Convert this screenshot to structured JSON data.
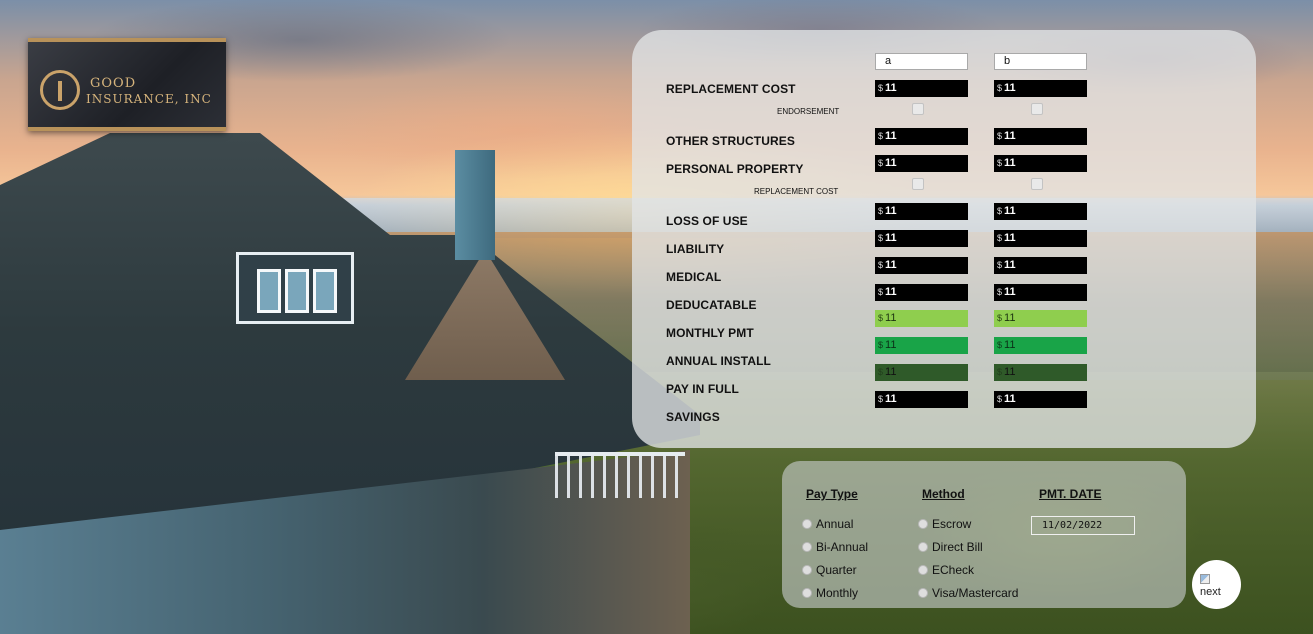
{
  "brand": {
    "line1": "GOOD",
    "line2": "INSURANCE, INC"
  },
  "columns": {
    "a_value": "a",
    "b_value": "b"
  },
  "currency_symbol": "$",
  "rows": {
    "replacement_cost": {
      "label": "REPLACEMENT COST",
      "a": "11",
      "b": "11"
    },
    "endorsement": {
      "label": "ENDORSEMENT"
    },
    "other_structures": {
      "label": "OTHER STRUCTURES",
      "a": "11",
      "b": "11"
    },
    "personal_property": {
      "label": "PERSONAL PROPERTY",
      "a": "11",
      "b": "11"
    },
    "pp_replacement_cost": {
      "label": "REPLACEMENT COST"
    },
    "loss_of_use": {
      "label": "LOSS OF USE",
      "a": "11",
      "b": "11"
    },
    "liability": {
      "label": "LIABILITY",
      "a": "11",
      "b": "11"
    },
    "medical": {
      "label": "MEDICAL",
      "a": "11",
      "b": "11"
    },
    "deducatable": {
      "label": "DEDUCATABLE",
      "a": "11",
      "b": "11"
    },
    "monthly_pmt": {
      "label": "MONTHLY PMT",
      "a": "11",
      "b": "11"
    },
    "annual_install": {
      "label": "ANNUAL INSTALL",
      "a": "11",
      "b": "11"
    },
    "pay_in_full": {
      "label": "PAY IN FULL",
      "a": "11",
      "b": "11"
    },
    "savings": {
      "label": "SAVINGS",
      "a": "11",
      "b": "11"
    }
  },
  "payment": {
    "pay_type_heading": "Pay Type",
    "pay_types": [
      "Annual",
      "Bi-Annual",
      "Quarter",
      "Monthly"
    ],
    "method_heading": "Method",
    "methods": [
      "Escrow",
      "Direct Bill",
      "ECheck",
      "Visa/Mastercard"
    ],
    "date_heading": "PMT. DATE",
    "date_value": "11/02/2022"
  },
  "next_button": {
    "alt_text": "next"
  },
  "colors": {
    "input_black": "#000000",
    "monthly_lime": "#8fce4e",
    "annual_green": "#19a448",
    "payfull_dark_green": "#2f5a29",
    "logo_gold": "#b8925a"
  }
}
